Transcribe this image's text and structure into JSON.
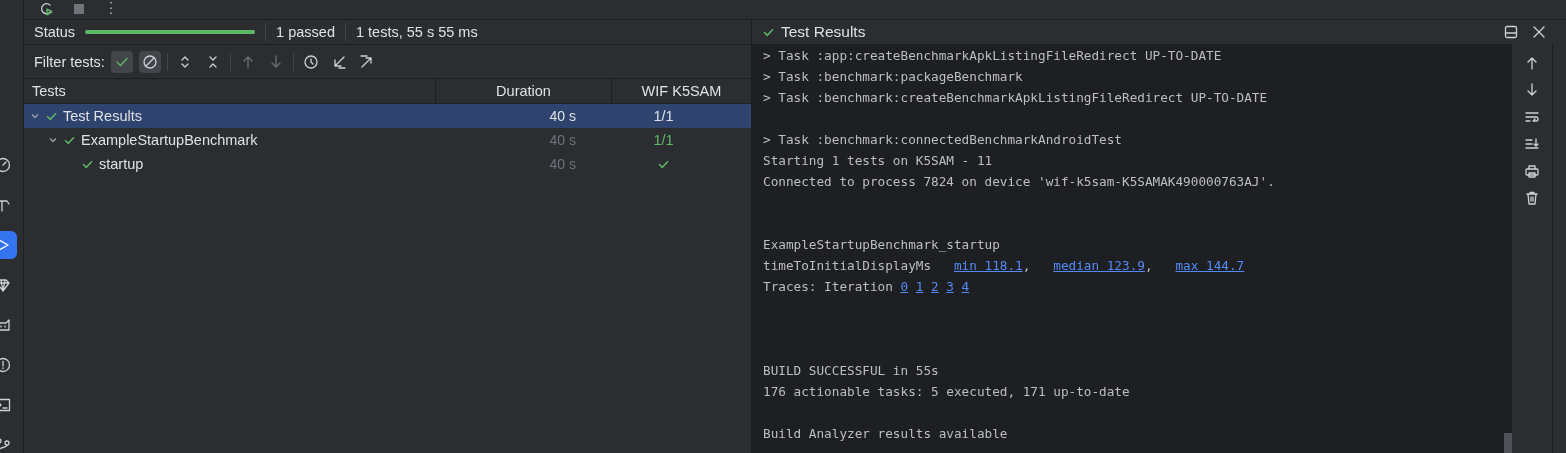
{
  "activity_bar": [
    {
      "selected": false
    },
    {
      "selected": false
    },
    {
      "selected": true
    },
    {
      "selected": false
    },
    {
      "selected": false
    },
    {
      "selected": false
    },
    {
      "selected": false
    },
    {
      "selected": false
    }
  ],
  "status": {
    "label": "Status",
    "level": 1,
    "passed": "1 passed",
    "summary": "1 tests, 55 s 55 ms"
  },
  "filter": {
    "label": "Filter tests:",
    "toggles": [
      {
        "on": true
      },
      {
        "on": true
      }
    ],
    "actions": [
      {
        "disabled": false
      },
      {
        "disabled": false
      },
      {
        "disabled": true
      },
      {
        "disabled": true
      },
      {
        "disabled": false
      },
      {
        "disabled": false
      },
      {
        "disabled": false
      }
    ]
  },
  "table": {
    "columns": [
      "Tests",
      "Duration",
      "WIF K5SAM"
    ],
    "rows": [
      {
        "name": "Test Results",
        "expanded": true,
        "selected": true,
        "duration": "40 s",
        "device": "1/1",
        "children": [
          {
            "name": "ExampleStartupBenchmark",
            "expanded": true,
            "selected": false,
            "duration": "40 s",
            "device": "1/1",
            "children": [
              {
                "name": "startup",
                "selected": false,
                "duration": "40 s",
                "device_check": true
              }
            ]
          }
        ]
      }
    ]
  },
  "console": {
    "title": "Test Results",
    "lines": [
      {
        "kind": "cut",
        "parts": [
          {
            "text": "> Task :app:createBenchmarkApkListingFileRedirect UP-TO-DATE"
          }
        ]
      },
      {
        "kind": "text",
        "parts": [
          {
            "text": "> Task :benchmark:packageBenchmark"
          }
        ]
      },
      {
        "kind": "text",
        "parts": [
          {
            "text": "> Task :benchmark:createBenchmarkApkListingFileRedirect UP-TO-DATE"
          }
        ]
      },
      {
        "kind": "blank"
      },
      {
        "kind": "text",
        "parts": [
          {
            "text": "> Task :benchmark:connectedBenchmarkAndroidTest"
          }
        ]
      },
      {
        "kind": "text",
        "parts": [
          {
            "text": "Starting 1 tests on K5SAM - 11"
          }
        ]
      },
      {
        "kind": "text",
        "parts": [
          {
            "text": "Connected to process 7824 on device 'wif-k5sam-K5SAMAK490000763AJ'."
          }
        ]
      },
      {
        "kind": "blank"
      },
      {
        "kind": "blank"
      },
      {
        "kind": "text",
        "parts": [
          {
            "text": "ExampleStartupBenchmark_startup"
          }
        ]
      },
      {
        "kind": "metrics",
        "parts": [
          {
            "text": "timeToInitialDisplayMs"
          },
          {
            "text": "min 118.1",
            "link": true
          },
          {
            "text": ","
          },
          {
            "text": "median 123.9",
            "link": true
          },
          {
            "text": ","
          },
          {
            "text": "max 144.7",
            "link": true
          }
        ]
      },
      {
        "kind": "traces",
        "parts": [
          {
            "text": "Traces: Iteration"
          },
          {
            "text": "0",
            "link": true
          },
          {
            "text": "1",
            "link": true
          },
          {
            "text": "2",
            "link": true
          },
          {
            "text": "3",
            "link": true
          },
          {
            "text": "4",
            "link": true
          }
        ]
      },
      {
        "kind": "blank"
      },
      {
        "kind": "blank"
      },
      {
        "kind": "blank"
      },
      {
        "kind": "text",
        "parts": [
          {
            "text": "BUILD SUCCESSFUL in 55s"
          }
        ]
      },
      {
        "kind": "text",
        "parts": [
          {
            "text": "176 actionable tasks: 5 executed, 171 up-to-date"
          }
        ]
      },
      {
        "kind": "blank"
      },
      {
        "kind": "text",
        "parts": [
          {
            "text": "Build Analyzer results available"
          }
        ]
      }
    ]
  }
}
